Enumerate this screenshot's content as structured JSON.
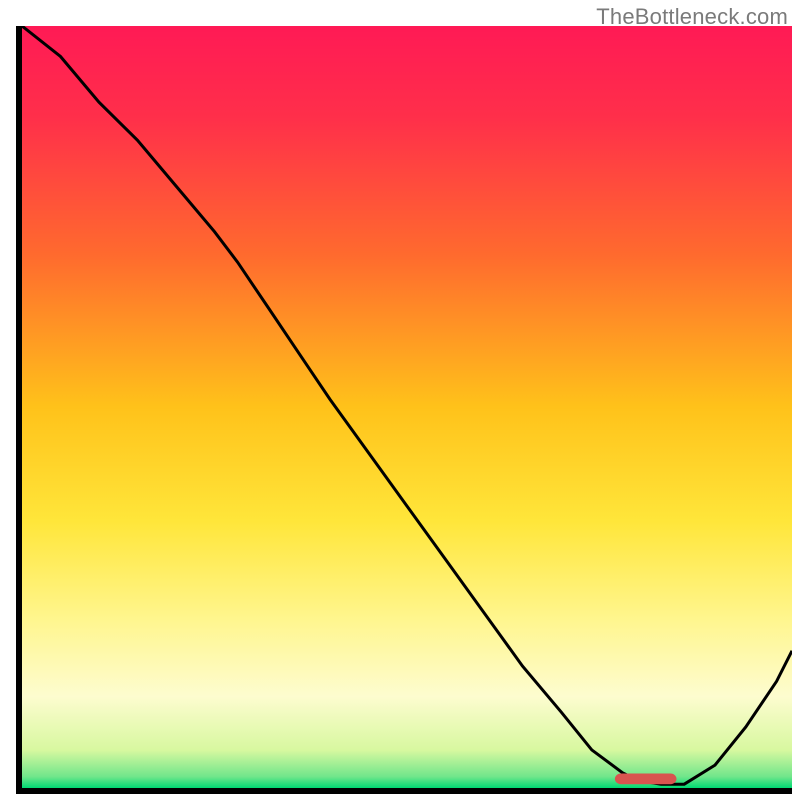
{
  "watermark": "TheBottleneck.com",
  "colors": {
    "axis": "#000000",
    "curve": "#000000",
    "marker_fill": "#d9544f",
    "gradient_stops": [
      {
        "offset": 0.0,
        "color": "#ff1a55"
      },
      {
        "offset": 0.12,
        "color": "#ff2f4a"
      },
      {
        "offset": 0.3,
        "color": "#ff6a2e"
      },
      {
        "offset": 0.5,
        "color": "#ffc21a"
      },
      {
        "offset": 0.65,
        "color": "#ffe63a"
      },
      {
        "offset": 0.78,
        "color": "#fff68f"
      },
      {
        "offset": 0.88,
        "color": "#fdfccf"
      },
      {
        "offset": 0.95,
        "color": "#d8f8a0"
      },
      {
        "offset": 0.985,
        "color": "#71e68b"
      },
      {
        "offset": 1.0,
        "color": "#00d973"
      }
    ]
  },
  "chart_data": {
    "type": "line",
    "title": "",
    "xlabel": "",
    "ylabel": "",
    "xlim": [
      0,
      100
    ],
    "ylim": [
      0,
      100
    ],
    "note": "Bottleneck-style curve. y≈0 is optimal (green); high y is red. Values read off the image; axes unlabeled so units are percent-of-range.",
    "x": [
      0,
      5,
      10,
      15,
      20,
      25,
      28,
      32,
      36,
      40,
      45,
      50,
      55,
      60,
      65,
      70,
      74,
      78,
      80,
      83,
      86,
      90,
      94,
      98,
      100
    ],
    "y": [
      100,
      96,
      90,
      85,
      79,
      73,
      69,
      63,
      57,
      51,
      44,
      37,
      30,
      23,
      16,
      10,
      5,
      2,
      1,
      0.5,
      0.5,
      3,
      8,
      14,
      18
    ],
    "optimal_marker": {
      "x_center": 81,
      "y": 1.2,
      "width": 8,
      "height": 1.4
    }
  }
}
